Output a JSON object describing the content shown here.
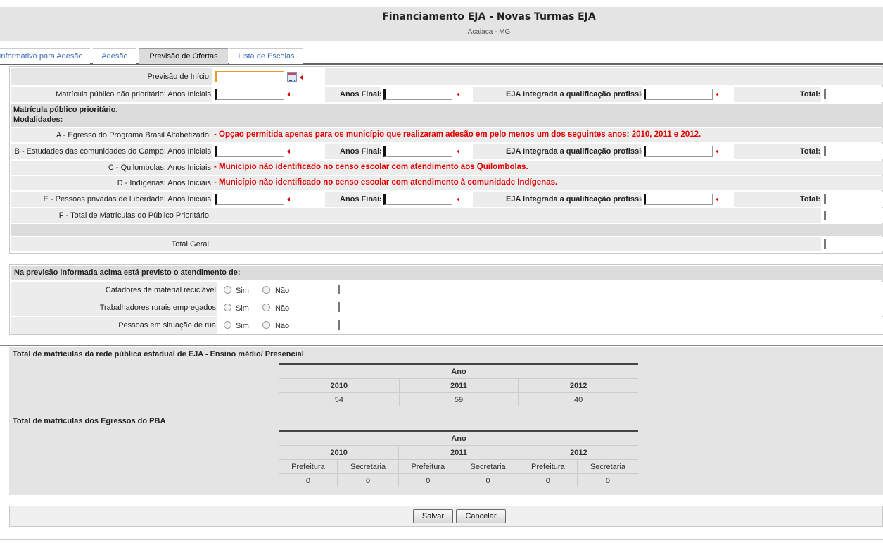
{
  "header": {
    "title": "Financiamento EJA - Novas Turmas EJA",
    "subtitle": "Acaiaca - MG"
  },
  "tabs": [
    "Informativo para Adesão",
    "Adesão",
    "Previsão de Ofertas",
    "Lista de Escolas"
  ],
  "form": {
    "previsao_inicio": "Previsão de Início:",
    "nao_prioritario": "Matrícula público não prioritário: Anos Iniciais",
    "anos_finais": "Anos Finais:",
    "eja_integrada": "EJA Integrada a qualificação profissional:",
    "total": "Total:",
    "prioritario_title": "Matrícula público prioritário.",
    "modalidades": "Modalidades:",
    "a_label": "A - Egresso do Programa Brasil Alfabetizado:",
    "a_msg": "- Opçao permitida apenas para os município que realizaram adesão em pelo menos um dos seguintes anos: 2010, 2011 e 2012.",
    "b_label": "B - Estudades das comunidades do Campo: Anos Iniciais",
    "c_label": "C - Quilombolas: Anos Iniciais",
    "c_msg": "- Município não identificado no censo escolar com atendimento aos Quilombolas.",
    "d_label": "D - Indígenas: Anos Iniciais",
    "d_msg": "- Município não identificado no censo escolar com atendimento à comunidade Indígenas.",
    "e_label": "E - Pessoas privadas de Liberdade: Anos Iniciais",
    "f_label": "F - Total de Matrículas do Público Prioritário:",
    "total_geral": "Total Geral:"
  },
  "atendimento": {
    "title": "Na previsão informada acima está previsto o atendimento de:",
    "rows": [
      "Catadores de material reciclável",
      "Trabalhadores rurais empregados",
      "Pessoas em situação de rua"
    ],
    "sim": "Sim",
    "nao": "Não"
  },
  "estadual": {
    "title": "Total de matrículas da rede pública estadual de EJA - Ensino médio/ Presencial",
    "ano": "Ano",
    "years": [
      "2010",
      "2011",
      "2012"
    ],
    "values": [
      "54",
      "59",
      "40"
    ]
  },
  "pba": {
    "title": "Total de matrículas dos Egressos do PBA",
    "ano": "Ano",
    "years": [
      "2010",
      "2011",
      "2012"
    ],
    "sub": [
      "Prefeitura",
      "Secretaria",
      "Prefeitura",
      "Secretaria",
      "Prefeitura",
      "Secretaria"
    ],
    "values": [
      "0",
      "0",
      "0",
      "0",
      "0",
      "0"
    ]
  },
  "buttons": {
    "salvar": "Salvar",
    "cancelar": "Cancelar"
  }
}
